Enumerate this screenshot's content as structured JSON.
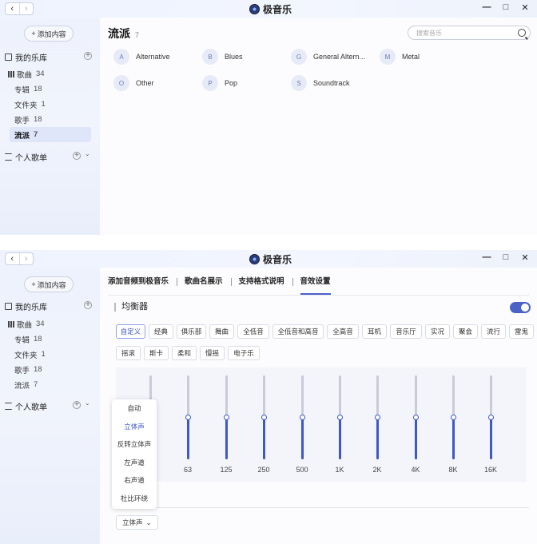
{
  "app": {
    "title": "极音乐",
    "nav_back": "‹",
    "nav_forward": "›",
    "win_min": "—",
    "win_max": "□",
    "win_close": "✕"
  },
  "sidebar": {
    "add_button": "添加内容",
    "library_title": "我的乐库",
    "items": [
      {
        "label": "歌曲",
        "count": "34"
      },
      {
        "label": "专辑",
        "count": "18"
      },
      {
        "label": "文件夹",
        "count": "1"
      },
      {
        "label": "歌手",
        "count": "18"
      },
      {
        "label": "流派",
        "count": "7"
      }
    ],
    "playlists_title": "个人歌单",
    "plus": "+",
    "chevron": "⌄"
  },
  "genre_page": {
    "title": "流派",
    "count": "7",
    "search_placeholder": "搜索音乐",
    "genres": [
      {
        "letter": "A",
        "name": "Alternative"
      },
      {
        "letter": "B",
        "name": "Blues"
      },
      {
        "letter": "G",
        "name": "General Altern..."
      },
      {
        "letter": "M",
        "name": "Metal"
      },
      {
        "letter": "O",
        "name": "Other"
      },
      {
        "letter": "P",
        "name": "Pop"
      },
      {
        "letter": "S",
        "name": "Soundtrack"
      }
    ]
  },
  "settings_page": {
    "tabs": [
      "添加音频到极音乐",
      "歌曲名展示",
      "支持格式说明",
      "音效设置"
    ],
    "active_tab": "音效设置",
    "eq_title": "均衡器",
    "eq_enabled": true,
    "presets_row1": [
      "自定义",
      "经典",
      "俱乐部",
      "舞曲",
      "全低音",
      "全低音和高音",
      "全高音",
      "耳机",
      "音乐厅",
      "实况",
      "聚会",
      "流行",
      "雷鬼"
    ],
    "presets_row2": [
      "摇滚",
      "斯卡",
      "柔和",
      "慢摇",
      "电子乐"
    ],
    "active_preset": "自定义",
    "bands": [
      {
        "freq": "",
        "level": 0.5
      },
      {
        "freq": "63",
        "level": 0.5
      },
      {
        "freq": "125",
        "level": 0.5
      },
      {
        "freq": "250",
        "level": 0.5
      },
      {
        "freq": "500",
        "level": 0.5
      },
      {
        "freq": "1K",
        "level": 0.5
      },
      {
        "freq": "2K",
        "level": 0.5
      },
      {
        "freq": "4K",
        "level": 0.5
      },
      {
        "freq": "8K",
        "level": 0.5
      },
      {
        "freq": "16K",
        "level": 0.5
      }
    ],
    "channel_menu": [
      "自动",
      "立体声",
      "反转立体声",
      "左声道",
      "右声道",
      "杜比环绕"
    ],
    "channel_selected": "立体声",
    "channel_button": "立体声",
    "channel_chevron": "⌄"
  },
  "colors": {
    "accent": "#4a62c6",
    "slider_fill": "#3d58c7",
    "sidebar_bg": "#eef2fd"
  }
}
